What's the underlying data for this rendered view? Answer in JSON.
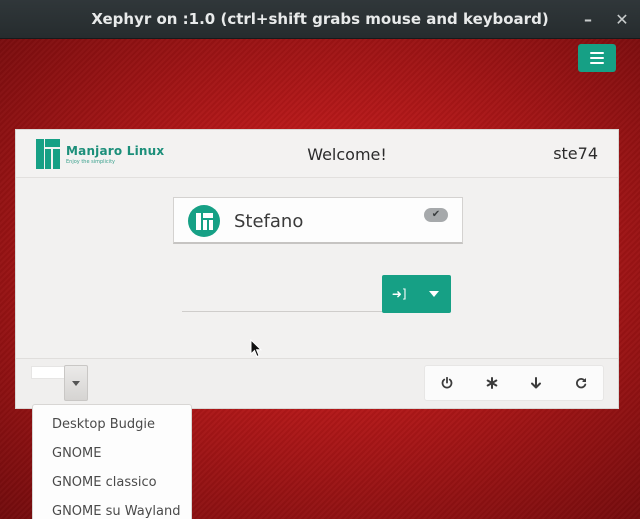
{
  "window": {
    "title": "Xephyr on :1.0 (ctrl+shift grabs mouse and keyboard)",
    "minimize_glyph": "–",
    "close_glyph": "✕"
  },
  "header": {
    "logo_name": "Manjaro Linux",
    "logo_tagline": "Enjoy the simplicity",
    "welcome": "Welcome!",
    "hostname": "ste74"
  },
  "user": {
    "name": "Stefano",
    "selected": true
  },
  "password": {
    "value": "",
    "placeholder": ""
  },
  "session": {
    "current": "",
    "options": [
      "Desktop Budgie",
      "GNOME",
      "GNOME classico",
      "GNOME su Wayland"
    ]
  },
  "icons": {
    "menu": "hamburger-icon",
    "login": "sign-in-icon",
    "login_options": "caret-down-icon",
    "power": "power-icon",
    "accessibility": "asterisk-icon",
    "suspend": "arrow-down-icon",
    "restart": "refresh-icon"
  },
  "colors": {
    "accent": "#16a085",
    "background": "#b8191a",
    "panel": "#f2f1f0"
  }
}
